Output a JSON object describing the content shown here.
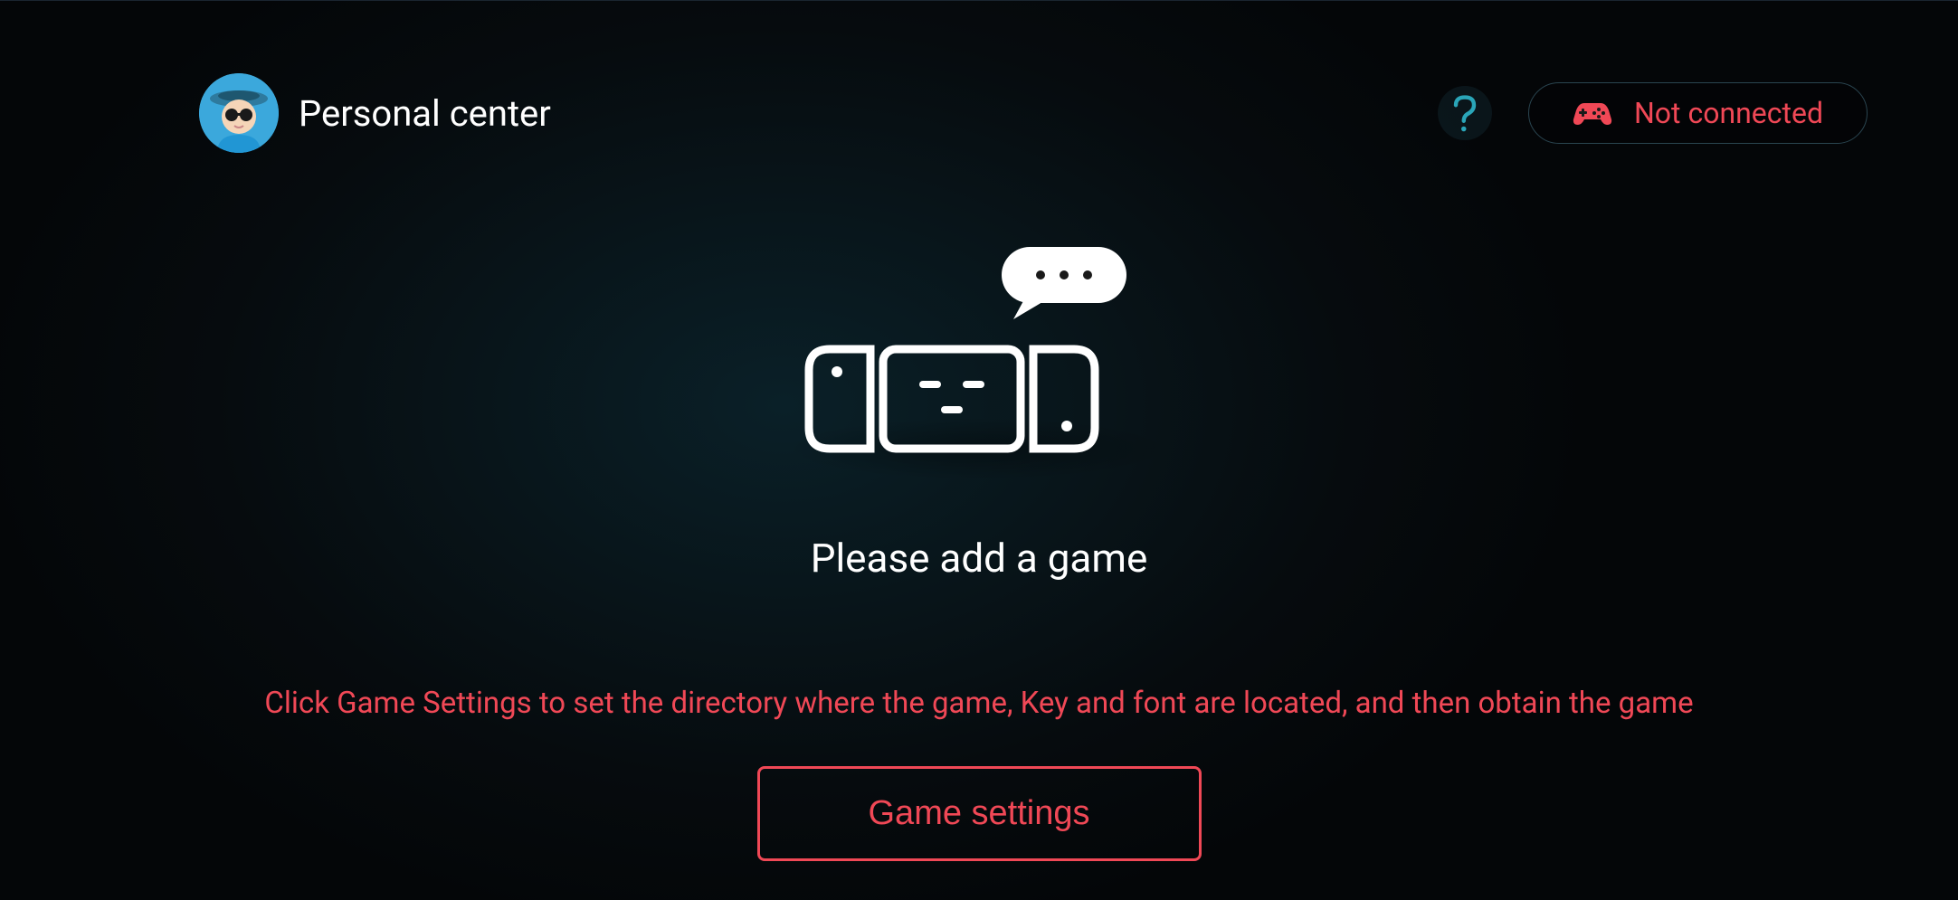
{
  "header": {
    "title": "Personal center",
    "connection_status": "Not connected"
  },
  "main": {
    "prompt_title": "Please add a game",
    "instruction": "Click Game Settings to set the directory where the game, Key and font are located, and then obtain the game",
    "button_label": "Game settings"
  },
  "colors": {
    "accent_red": "#f04856",
    "accent_teal": "#2aa5b8",
    "background": "#081419"
  }
}
